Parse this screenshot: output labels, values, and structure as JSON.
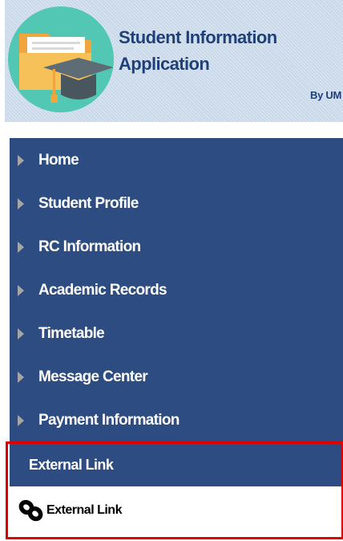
{
  "header": {
    "title_line1": "Student Information",
    "title_line2": "Application",
    "by_line": "By UM",
    "logo_icon": "folder-graduation-cap-icon"
  },
  "nav": {
    "items": [
      {
        "label": "Home",
        "icon": "caret-right-icon"
      },
      {
        "label": "Student Profile",
        "icon": "caret-right-icon"
      },
      {
        "label": "RC Information",
        "icon": "caret-right-icon"
      },
      {
        "label": "Academic Records",
        "icon": "caret-right-icon"
      },
      {
        "label": "Timetable",
        "icon": "caret-right-icon"
      },
      {
        "label": "Message Center",
        "icon": "caret-right-icon"
      },
      {
        "label": "Payment Information",
        "icon": "caret-right-icon"
      }
    ]
  },
  "external": {
    "header_label": "External Link",
    "link_label": "External Link",
    "link_icon": "chain-link-icon",
    "highlight_color": "#e00000"
  },
  "colors": {
    "nav_background": "#2c4c82",
    "header_background": "#c9d9ea",
    "title_text": "#1f3f7a",
    "logo_circle": "#52c7b3"
  }
}
